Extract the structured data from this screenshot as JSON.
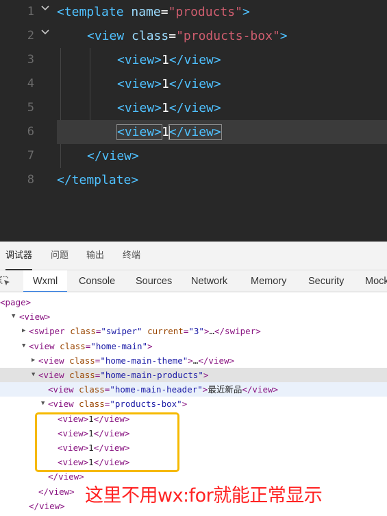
{
  "editor": {
    "lines": [
      {
        "no": "1",
        "tokens": [
          [
            "tk-tag",
            "<template"
          ],
          [
            "tk-attr",
            " name"
          ],
          [
            "tk-txt",
            "="
          ],
          [
            "tk-str",
            "\"products\""
          ],
          [
            "tk-tag",
            ">"
          ]
        ]
      },
      {
        "no": "2",
        "tokens": [
          [
            "tk-tag",
            "<view"
          ],
          [
            "tk-attr",
            " class"
          ],
          [
            "tk-txt",
            "="
          ],
          [
            "tk-str",
            "\"products-box\""
          ],
          [
            "tk-tag",
            ">"
          ]
        ]
      },
      {
        "no": "3",
        "tokens": [
          [
            "tk-tag",
            "<view>"
          ],
          [
            "tk-txt",
            "1"
          ],
          [
            "tk-tag",
            "</view>"
          ]
        ]
      },
      {
        "no": "4",
        "tokens": [
          [
            "tk-tag",
            "<view>"
          ],
          [
            "tk-txt",
            "1"
          ],
          [
            "tk-tag",
            "</view>"
          ]
        ]
      },
      {
        "no": "5",
        "tokens": [
          [
            "tk-tag",
            "<view>"
          ],
          [
            "tk-txt",
            "1"
          ],
          [
            "tk-tag",
            "</view>"
          ]
        ]
      },
      {
        "no": "6",
        "tokens": [
          [
            "tk-tag",
            "<view>"
          ],
          [
            "tk-txt",
            "1"
          ],
          [
            "tk-tag",
            "</view>"
          ]
        ]
      },
      {
        "no": "7",
        "tokens": [
          [
            "tk-tag",
            "</view>"
          ]
        ]
      },
      {
        "no": "8",
        "tokens": [
          [
            "tk-tag",
            "</template>"
          ]
        ]
      }
    ]
  },
  "panel_tabs": [
    "调试器",
    "问题",
    "输出",
    "终端"
  ],
  "tool_tabs": [
    "Wxml",
    "Console",
    "Sources",
    "Network",
    "Memory",
    "Security",
    "Mock"
  ],
  "tree": {
    "rows": [
      {
        "tri": "",
        "parts": [
          [
            "x-punc",
            "<"
          ],
          [
            "x-tag",
            "page"
          ],
          [
            "x-punc",
            ">"
          ]
        ]
      },
      {
        "tri": "▼",
        "parts": [
          [
            "x-punc",
            "<"
          ],
          [
            "x-tag",
            "view"
          ],
          [
            "x-punc",
            ">"
          ]
        ]
      },
      {
        "tri": "▶",
        "parts": [
          [
            "x-punc",
            "<"
          ],
          [
            "x-tag",
            "swiper"
          ],
          [
            "x-attr",
            " class"
          ],
          [
            "x-punc",
            "="
          ],
          [
            "x-val",
            "\"swiper\""
          ],
          [
            "x-attr",
            " current"
          ],
          [
            "x-punc",
            "="
          ],
          [
            "x-val",
            "\"3\""
          ],
          [
            "x-punc",
            ">"
          ],
          [
            "x-txt",
            "…"
          ],
          [
            "x-punc",
            "</"
          ],
          [
            "x-tag",
            "swiper"
          ],
          [
            "x-punc",
            ">"
          ]
        ]
      },
      {
        "tri": "▼",
        "parts": [
          [
            "x-punc",
            "<"
          ],
          [
            "x-tag",
            "view"
          ],
          [
            "x-attr",
            " class"
          ],
          [
            "x-punc",
            "="
          ],
          [
            "x-val",
            "\"home-main\""
          ],
          [
            "x-punc",
            ">"
          ]
        ]
      },
      {
        "tri": "▶",
        "parts": [
          [
            "x-punc",
            "<"
          ],
          [
            "x-tag",
            "view"
          ],
          [
            "x-attr",
            " class"
          ],
          [
            "x-punc",
            "="
          ],
          [
            "x-val",
            "\"home-main-theme\""
          ],
          [
            "x-punc",
            ">"
          ],
          [
            "x-txt",
            "…"
          ],
          [
            "x-punc",
            "</"
          ],
          [
            "x-tag",
            "view"
          ],
          [
            "x-punc",
            ">"
          ]
        ]
      },
      {
        "tri": "▼",
        "parts": [
          [
            "x-punc",
            "<"
          ],
          [
            "x-tag",
            "view"
          ],
          [
            "x-attr",
            " class"
          ],
          [
            "x-punc",
            "="
          ],
          [
            "x-val",
            "\"home-main-products\""
          ],
          [
            "x-punc",
            ">"
          ]
        ]
      },
      {
        "tri": "",
        "parts": [
          [
            "x-punc",
            "<"
          ],
          [
            "x-tag",
            "view"
          ],
          [
            "x-attr",
            " class"
          ],
          [
            "x-punc",
            "="
          ],
          [
            "x-val",
            "\"home-main-header\""
          ],
          [
            "x-punc",
            ">"
          ],
          [
            "x-txt",
            "最近新品"
          ],
          [
            "x-punc",
            "</"
          ],
          [
            "x-tag",
            "view"
          ],
          [
            "x-punc",
            ">"
          ]
        ]
      },
      {
        "tri": "▼",
        "parts": [
          [
            "x-punc",
            "<"
          ],
          [
            "x-tag",
            "view"
          ],
          [
            "x-attr",
            " class"
          ],
          [
            "x-punc",
            "="
          ],
          [
            "x-val",
            "\"products-box\""
          ],
          [
            "x-punc",
            ">"
          ]
        ]
      },
      {
        "tri": "",
        "parts": [
          [
            "x-punc",
            "<"
          ],
          [
            "x-tag",
            "view"
          ],
          [
            "x-punc",
            ">"
          ],
          [
            "x-txt",
            "1"
          ],
          [
            "x-punc",
            "</"
          ],
          [
            "x-tag",
            "view"
          ],
          [
            "x-punc",
            ">"
          ]
        ]
      },
      {
        "tri": "",
        "parts": [
          [
            "x-punc",
            "<"
          ],
          [
            "x-tag",
            "view"
          ],
          [
            "x-punc",
            ">"
          ],
          [
            "x-txt",
            "1"
          ],
          [
            "x-punc",
            "</"
          ],
          [
            "x-tag",
            "view"
          ],
          [
            "x-punc",
            ">"
          ]
        ]
      },
      {
        "tri": "",
        "parts": [
          [
            "x-punc",
            "<"
          ],
          [
            "x-tag",
            "view"
          ],
          [
            "x-punc",
            ">"
          ],
          [
            "x-txt",
            "1"
          ],
          [
            "x-punc",
            "</"
          ],
          [
            "x-tag",
            "view"
          ],
          [
            "x-punc",
            ">"
          ]
        ]
      },
      {
        "tri": "",
        "parts": [
          [
            "x-punc",
            "<"
          ],
          [
            "x-tag",
            "view"
          ],
          [
            "x-punc",
            ">"
          ],
          [
            "x-txt",
            "1"
          ],
          [
            "x-punc",
            "</"
          ],
          [
            "x-tag",
            "view"
          ],
          [
            "x-punc",
            ">"
          ]
        ]
      },
      {
        "tri": "",
        "parts": [
          [
            "x-punc",
            "</"
          ],
          [
            "x-tag",
            "view"
          ],
          [
            "x-punc",
            ">"
          ]
        ]
      },
      {
        "tri": "",
        "parts": [
          [
            "x-punc",
            "</"
          ],
          [
            "x-tag",
            "view"
          ],
          [
            "x-punc",
            ">"
          ]
        ]
      },
      {
        "tri": "",
        "parts": [
          [
            "x-punc",
            "</"
          ],
          [
            "x-tag",
            "view"
          ],
          [
            "x-punc",
            ">"
          ]
        ]
      }
    ]
  },
  "annotation": {
    "text": "这里不用wx:for就能正常显示",
    "color": "#ff2222",
    "box_color": "#f6b900"
  },
  "icons": {
    "inspect": "inspect-element-icon",
    "fold": "chevron-down-icon"
  }
}
